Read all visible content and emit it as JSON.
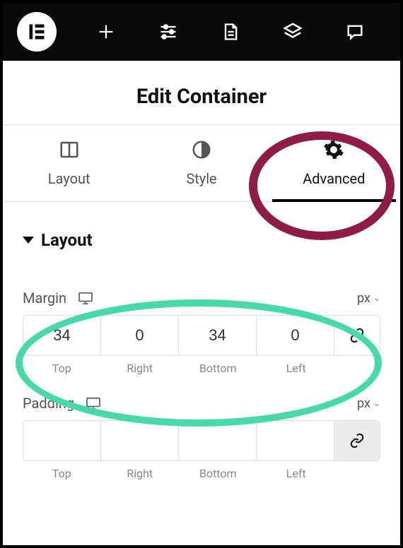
{
  "topbar": {
    "logo": "elementor-logo",
    "buttons": [
      "add-icon",
      "settings-icon",
      "page-icon",
      "layers-icon",
      "comment-icon"
    ]
  },
  "panel": {
    "title": "Edit Container"
  },
  "tabs": [
    {
      "label": "Layout",
      "icon": "layout-icon",
      "active": false
    },
    {
      "label": "Style",
      "icon": "style-icon",
      "active": false
    },
    {
      "label": "Advanced",
      "icon": "gear-icon",
      "active": true
    }
  ],
  "section": {
    "title": "Layout"
  },
  "controls": {
    "margin": {
      "label": "Margin",
      "unit": "px",
      "values": {
        "top": "34",
        "right": "0",
        "bottom": "34",
        "left": "0"
      },
      "side_labels": {
        "top": "Top",
        "right": "Right",
        "bottom": "Bottom",
        "left": "Left"
      },
      "linked": false
    },
    "padding": {
      "label": "Padding",
      "unit": "px",
      "values": {
        "top": "",
        "right": "",
        "bottom": "",
        "left": ""
      },
      "side_labels": {
        "top": "Top",
        "right": "Right",
        "bottom": "Bottom",
        "left": "Left"
      },
      "linked": true
    }
  }
}
